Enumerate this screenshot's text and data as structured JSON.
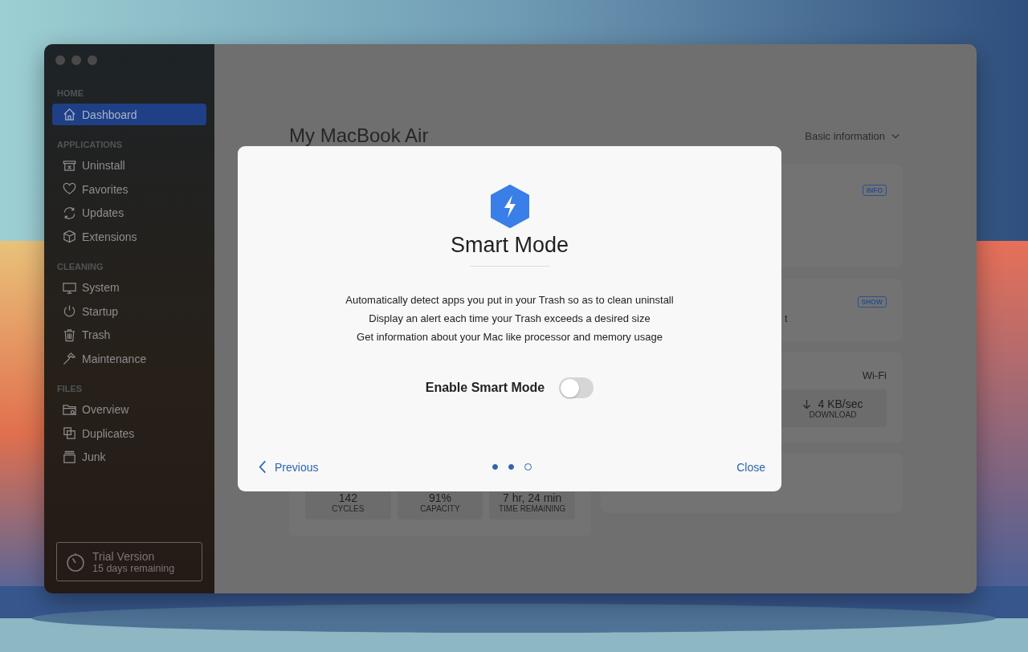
{
  "sidebar": {
    "sections": [
      {
        "title": "HOME",
        "items": [
          {
            "label": "Dashboard",
            "selected": true
          }
        ]
      },
      {
        "title": "APPLICATIONS",
        "items": [
          {
            "label": "Uninstall",
            "selected": false
          },
          {
            "label": "Favorites",
            "selected": false
          },
          {
            "label": "Updates",
            "selected": false
          },
          {
            "label": "Extensions",
            "selected": false
          }
        ]
      },
      {
        "title": "CLEANING",
        "items": [
          {
            "label": "System",
            "selected": false
          },
          {
            "label": "Startup",
            "selected": false
          },
          {
            "label": "Trash",
            "selected": false
          },
          {
            "label": "Maintenance",
            "selected": false
          }
        ]
      },
      {
        "title": "FILES",
        "items": [
          {
            "label": "Overview",
            "selected": false
          },
          {
            "label": "Duplicates",
            "selected": false
          },
          {
            "label": "Junk",
            "selected": false
          }
        ]
      }
    ],
    "trial": {
      "title": "Trial Version",
      "subtitle": "15 days remaining"
    }
  },
  "main": {
    "title": "My MacBook Air",
    "view_menu": "Basic information",
    "battery_stats": [
      {
        "value": "142",
        "label": "CYCLES"
      },
      {
        "value": "91%",
        "label": "CAPACITY"
      },
      {
        "value": "7 hr, 24 min",
        "label": "TIME REMAINING"
      }
    ],
    "info_card": {
      "badge": "INFO"
    },
    "show_card": {
      "badge": "SHOW",
      "text_fragment": "t"
    },
    "network_card": {
      "connection": "Wi-Fi",
      "download": {
        "value": "4 KB/sec",
        "label": "DOWNLOAD"
      }
    }
  },
  "dialog": {
    "title": "Smart Mode",
    "lines": [
      "Automatically detect apps you put in your Trash so as to clean uninstall",
      "Display an alert each time your Trash exceeds a desired size",
      "Get information about your Mac like processor and memory usage"
    ],
    "toggle": {
      "label": "Enable Smart Mode",
      "on": false
    },
    "previous": "Previous",
    "close": "Close",
    "pages": [
      {
        "filled": true
      },
      {
        "filled": true
      },
      {
        "filled": false
      }
    ]
  }
}
